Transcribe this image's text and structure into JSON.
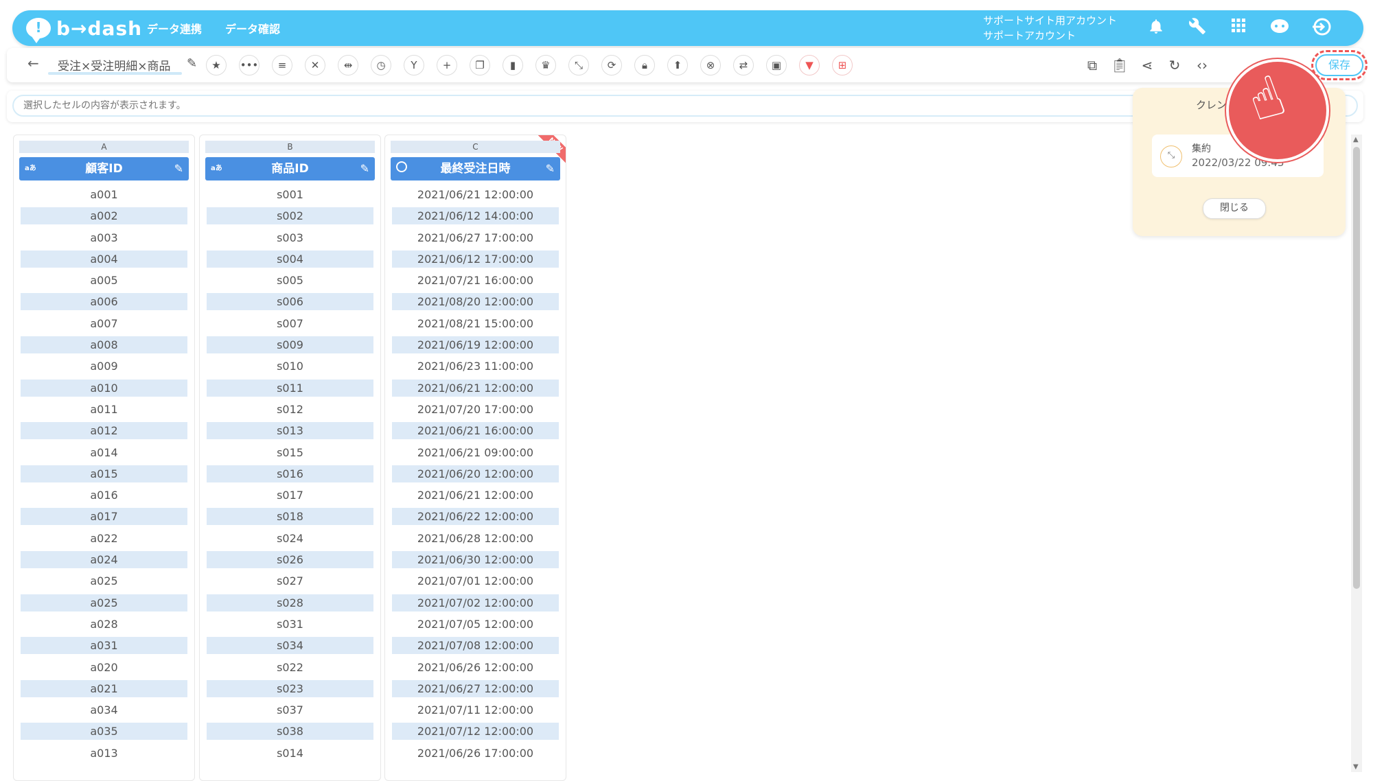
{
  "header": {
    "logo_text": "b→dash",
    "nav": [
      "データ連携",
      "データ確認"
    ],
    "account_line1": "サポートサイト用アカウント",
    "account_line2": "サポートアカウント"
  },
  "toolbar": {
    "title": "受注×受注明細×商品",
    "save_label": "保存"
  },
  "formula": {
    "placeholder": "選択したセルの内容が表示されます。"
  },
  "columns": [
    {
      "letter": "A",
      "type": "aあ",
      "name": "顧客ID",
      "values": [
        "a001",
        "a002",
        "a003",
        "a004",
        "a005",
        "a006",
        "a007",
        "a008",
        "a009",
        "a010",
        "a011",
        "a012",
        "a014",
        "a015",
        "a016",
        "a017",
        "a022",
        "a024",
        "a025",
        "a025",
        "a028",
        "a031",
        "a020",
        "a021",
        "a034",
        "a035",
        "a013"
      ]
    },
    {
      "letter": "B",
      "type": "aあ",
      "name": "商品ID",
      "values": [
        "s001",
        "s002",
        "s003",
        "s004",
        "s005",
        "s006",
        "s007",
        "s009",
        "s010",
        "s011",
        "s012",
        "s013",
        "s015",
        "s016",
        "s017",
        "s018",
        "s024",
        "s026",
        "s027",
        "s028",
        "s031",
        "s034",
        "s022",
        "s023",
        "s037",
        "s038",
        "s014"
      ]
    },
    {
      "letter": "C",
      "type": "datetime",
      "name": "最終受注日時",
      "is_new": true,
      "new_label": "NEW",
      "values": [
        "2021/06/21 12:00:00",
        "2021/06/12 14:00:00",
        "2021/06/27 17:00:00",
        "2021/06/12 17:00:00",
        "2021/07/21 16:00:00",
        "2021/08/20 12:00:00",
        "2021/08/21 15:00:00",
        "2021/06/19 12:00:00",
        "2021/06/23 11:00:00",
        "2021/06/21 12:00:00",
        "2021/07/20 17:00:00",
        "2021/06/21 16:00:00",
        "2021/06/21 09:00:00",
        "2021/06/20 12:00:00",
        "2021/06/21 12:00:00",
        "2021/06/22 12:00:00",
        "2021/06/28 12:00:00",
        "2021/06/30 12:00:00",
        "2021/07/01 12:00:00",
        "2021/07/02 12:00:00",
        "2021/07/05 12:00:00",
        "2021/07/08 12:00:00",
        "2021/06/26 12:00:00",
        "2021/06/27 12:00:00",
        "2021/07/11 12:00:00",
        "2021/07/12 12:00:00",
        "2021/06/26 17:00:00"
      ]
    }
  ],
  "popup": {
    "title": "クレン",
    "item_label": "集約",
    "item_date": "2022/03/22 09:43",
    "close_label": "閉じる"
  },
  "colors": {
    "accent": "#4fc6f6",
    "header_blue": "#4a90e2",
    "highlight_red": "#e95b5b",
    "row_alt": "#ddeaf7"
  }
}
